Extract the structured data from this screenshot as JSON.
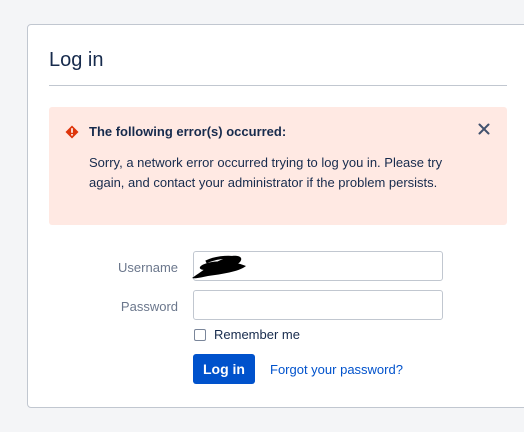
{
  "page": {
    "title": "Log in"
  },
  "error": {
    "title": "The following error(s) occurred:",
    "message": "Sorry, a network error occurred trying to log you in. Please try again, and contact your administrator if the problem persists.",
    "icon": "error-icon",
    "close_icon": "close-icon",
    "color_background": "#ffe9e3",
    "color_icon": "#de350b"
  },
  "form": {
    "username_label": "Username",
    "username_value": "",
    "password_label": "Password",
    "password_value": "",
    "remember_label": "Remember me",
    "remember_checked": false,
    "login_button": "Log in",
    "forgot_link": "Forgot your password?"
  },
  "colors": {
    "primary": "#0052cc",
    "link": "#0052cc"
  }
}
